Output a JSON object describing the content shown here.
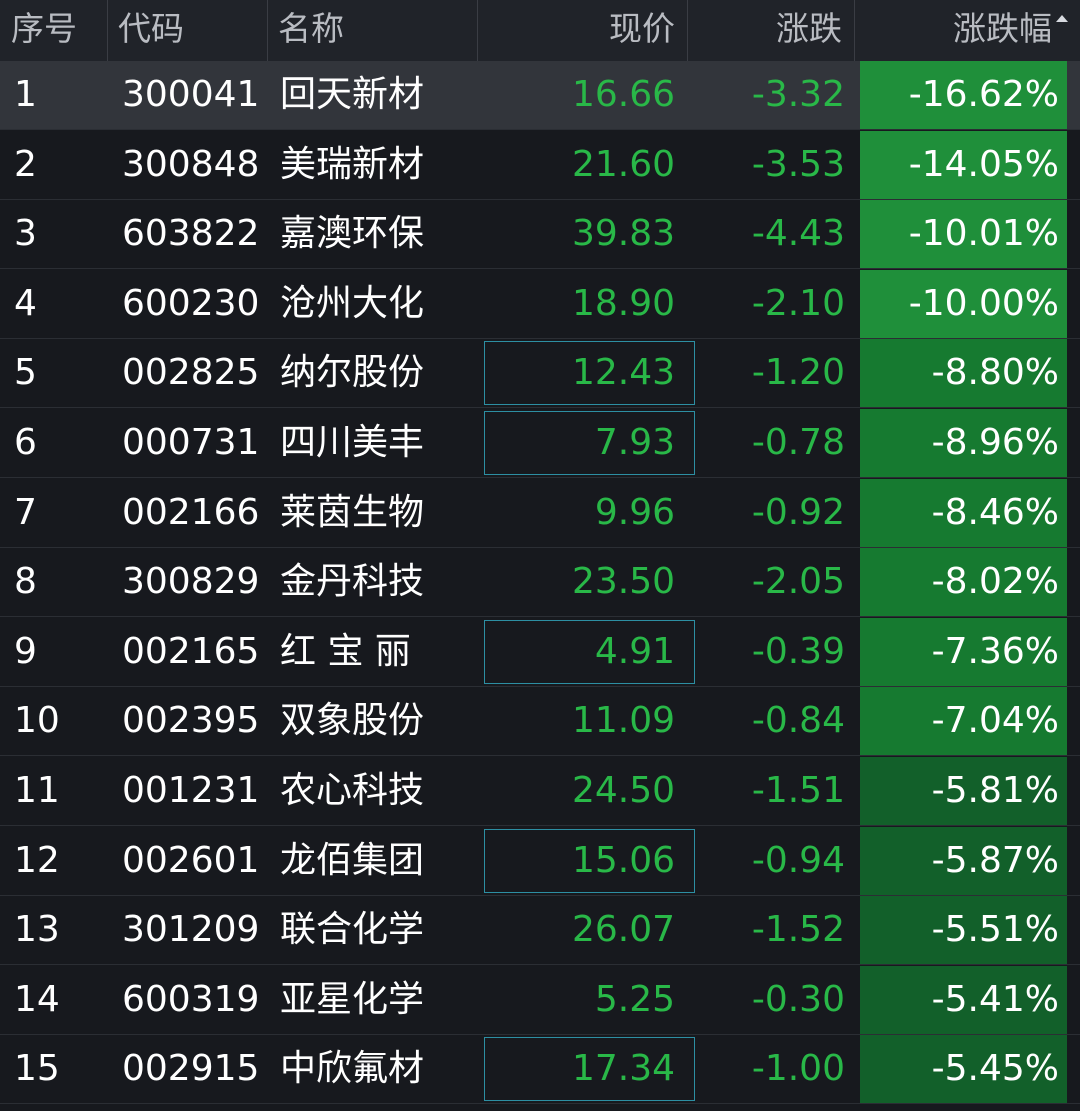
{
  "header": {
    "idx": "序号",
    "code": "代码",
    "name": "名称",
    "price": "现价",
    "change": "涨跌",
    "change_pct": "涨跌幅"
  },
  "colors": {
    "down_text": "#29b848",
    "pct_strong": "#1f8f3a",
    "pct_medium": "#167a30",
    "pct_light": "#12602a"
  },
  "rows": [
    {
      "idx": "1",
      "code": "300041",
      "name": "回天新材",
      "price": "16.66",
      "change": "-3.32",
      "change_pct": "-16.62%",
      "level": "strong",
      "boxed": false,
      "selected": true
    },
    {
      "idx": "2",
      "code": "300848",
      "name": "美瑞新材",
      "price": "21.60",
      "change": "-3.53",
      "change_pct": "-14.05%",
      "level": "strong",
      "boxed": false,
      "selected": false
    },
    {
      "idx": "3",
      "code": "603822",
      "name": "嘉澳环保",
      "price": "39.83",
      "change": "-4.43",
      "change_pct": "-10.01%",
      "level": "strong",
      "boxed": false,
      "selected": false
    },
    {
      "idx": "4",
      "code": "600230",
      "name": "沧州大化",
      "price": "18.90",
      "change": "-2.10",
      "change_pct": "-10.00%",
      "level": "strong",
      "boxed": false,
      "selected": false
    },
    {
      "idx": "5",
      "code": "002825",
      "name": "纳尔股份",
      "price": "12.43",
      "change": "-1.20",
      "change_pct": "-8.80%",
      "level": "medium",
      "boxed": true,
      "selected": false
    },
    {
      "idx": "6",
      "code": "000731",
      "name": "四川美丰",
      "price": "7.93",
      "change": "-0.78",
      "change_pct": "-8.96%",
      "level": "medium",
      "boxed": true,
      "selected": false
    },
    {
      "idx": "7",
      "code": "002166",
      "name": "莱茵生物",
      "price": "9.96",
      "change": "-0.92",
      "change_pct": "-8.46%",
      "level": "medium",
      "boxed": false,
      "selected": false
    },
    {
      "idx": "8",
      "code": "300829",
      "name": "金丹科技",
      "price": "23.50",
      "change": "-2.05",
      "change_pct": "-8.02%",
      "level": "medium",
      "boxed": false,
      "selected": false
    },
    {
      "idx": "9",
      "code": "002165",
      "name": "红 宝 丽",
      "price": "4.91",
      "change": "-0.39",
      "change_pct": "-7.36%",
      "level": "medium",
      "boxed": true,
      "selected": false
    },
    {
      "idx": "10",
      "code": "002395",
      "name": "双象股份",
      "price": "11.09",
      "change": "-0.84",
      "change_pct": "-7.04%",
      "level": "medium",
      "boxed": false,
      "selected": false
    },
    {
      "idx": "11",
      "code": "001231",
      "name": "农心科技",
      "price": "24.50",
      "change": "-1.51",
      "change_pct": "-5.81%",
      "level": "light",
      "boxed": false,
      "selected": false
    },
    {
      "idx": "12",
      "code": "002601",
      "name": "龙佰集团",
      "price": "15.06",
      "change": "-0.94",
      "change_pct": "-5.87%",
      "level": "light",
      "boxed": true,
      "selected": false
    },
    {
      "idx": "13",
      "code": "301209",
      "name": "联合化学",
      "price": "26.07",
      "change": "-1.52",
      "change_pct": "-5.51%",
      "level": "light",
      "boxed": false,
      "selected": false
    },
    {
      "idx": "14",
      "code": "600319",
      "name": "亚星化学",
      "price": "5.25",
      "change": "-0.30",
      "change_pct": "-5.41%",
      "level": "light",
      "boxed": false,
      "selected": false
    },
    {
      "idx": "15",
      "code": "002915",
      "name": "中欣氟材",
      "price": "17.34",
      "change": "-1.00",
      "change_pct": "-5.45%",
      "level": "light",
      "boxed": true,
      "selected": false
    }
  ]
}
